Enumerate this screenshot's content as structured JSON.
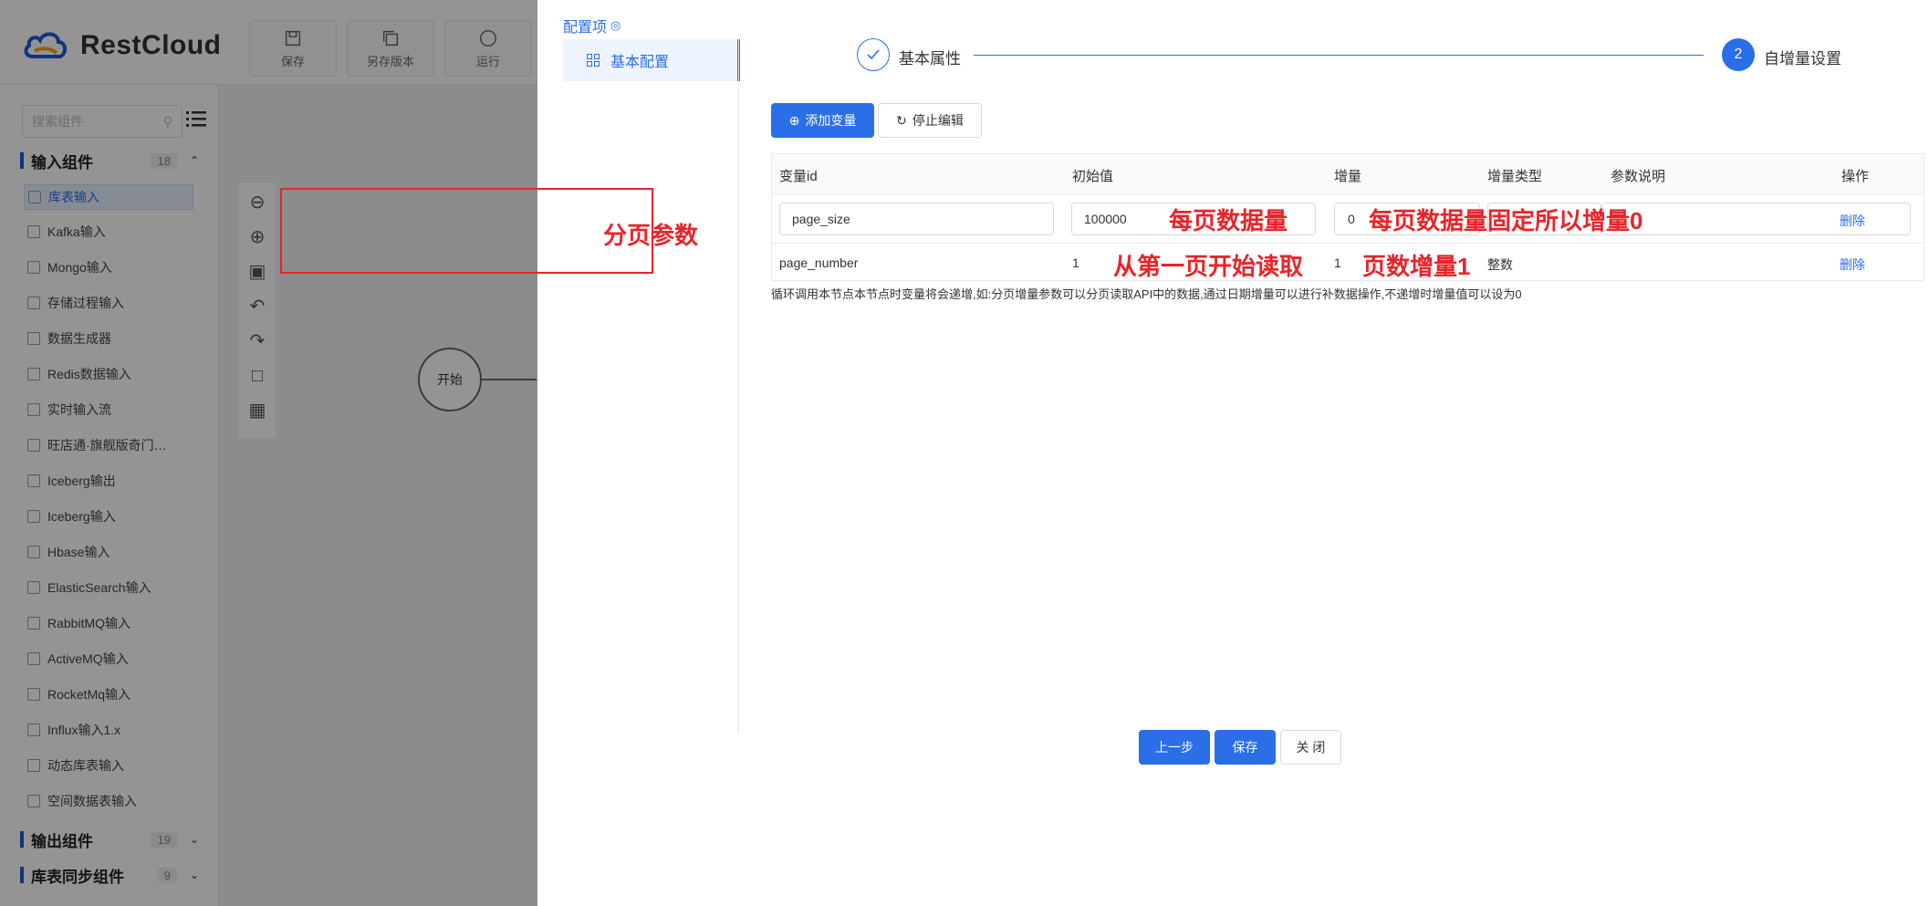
{
  "app": {
    "logo_text": "RestCloud",
    "toolbar": [
      {
        "label": "保存",
        "icon": "save-icon"
      },
      {
        "label": "另存版本",
        "icon": "copy-icon"
      },
      {
        "label": "运行",
        "icon": "run-icon"
      }
    ],
    "search_placeholder": "搜索组件",
    "groups": [
      {
        "title": "输入组件",
        "count": "18"
      },
      {
        "title": "输出组件",
        "count": "19"
      },
      {
        "title": "库表同步组件",
        "count": "9"
      }
    ],
    "components": [
      "库表输入",
      "Kafka输入",
      "Mongo输入",
      "存储过程输入",
      "数据生成器",
      "Redis数据输入",
      "实时输入流",
      "旺店通·旗舰版奇门…",
      "Iceberg输出",
      "Iceberg输入",
      "Hbase输入",
      "ElasticSearch输入",
      "RabbitMQ输入",
      "ActiveMQ输入",
      "RocketMq输入",
      "Influx输入1.x",
      "动态库表输入",
      "空间数据表输入"
    ],
    "start_node": "开始"
  },
  "drawer": {
    "config_label": "配置项",
    "nav_item": "基本配置",
    "steps": {
      "step1_label": "基本属性",
      "step2_number": "2",
      "step2_label": "自增量设置"
    },
    "buttons": {
      "add_variable": "添加变量",
      "stop_edit": "停止编辑"
    },
    "table": {
      "headers": [
        "变量id",
        "初始值",
        "增量",
        "增量类型",
        "参数说明",
        "操作"
      ],
      "rows": [
        {
          "id": "page_size",
          "initial": "100000",
          "increment": "0",
          "type": "",
          "desc": "",
          "action": "删除"
        },
        {
          "id": "page_number",
          "initial": "1",
          "increment": "1",
          "type": "整数",
          "desc": "",
          "action": "删除"
        }
      ]
    },
    "hint": "循环调用本节点本节点时变量将会递增,如:分页增量参数可以分页读取API中的数据,通过日期增量可以进行补数据操作,不递增时增量值可以设为0",
    "annotations": {
      "paging_params": "分页参数",
      "rows_per_page": "每页数据量",
      "fixed_zero": "每页数据量固定所以增量0",
      "start_from_first": "从第一页开始读取",
      "page_increment": "页数增量1"
    },
    "footer": {
      "prev": "上一步",
      "save": "保存",
      "close": "关 闭"
    }
  },
  "colors": {
    "primary": "#2a6ee8",
    "annotation_red": "#e8242a"
  }
}
